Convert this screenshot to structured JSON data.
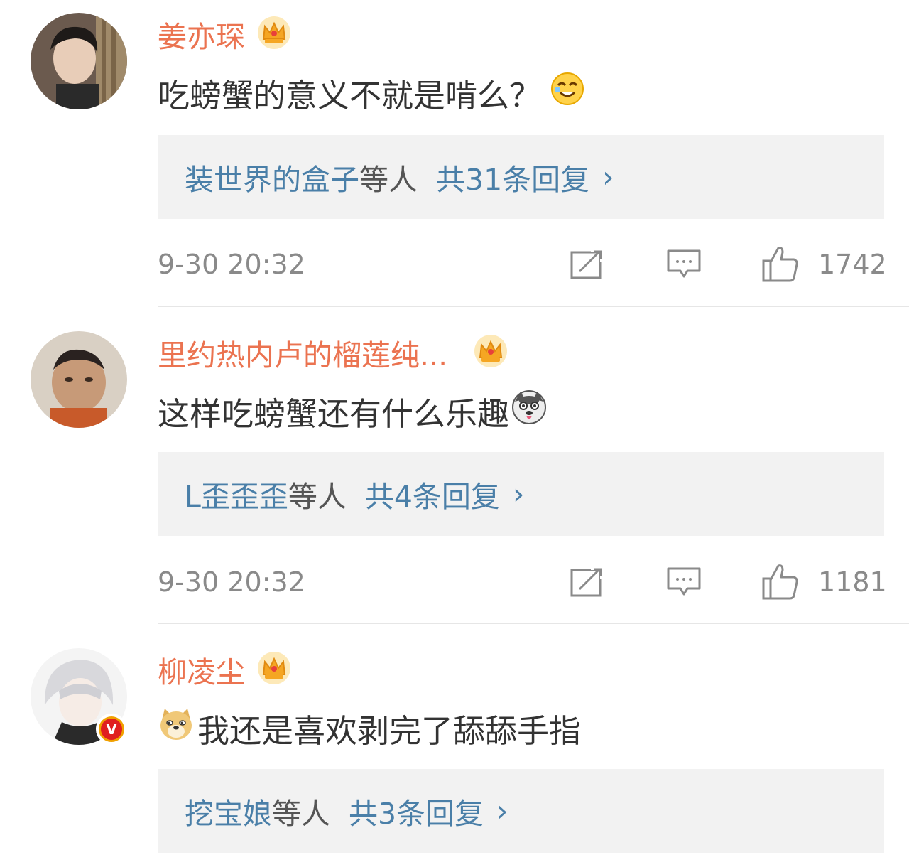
{
  "comments": [
    {
      "username": "姜亦琛",
      "text": "吃螃蟹的意义不就是啃么？",
      "emoji": "laughing-face-emoji",
      "reply_names": "装世界的盒子",
      "reply_others": "等人",
      "reply_count": "共31条回复",
      "reply_chevron": "›",
      "timestamp": "9-30 20:32",
      "likes": "1742",
      "badge": "crown-icon",
      "verified": false
    },
    {
      "username": "里约热内卢的榴莲纯...",
      "text": "这样吃螃蟹还有什么乐趣",
      "emoji": "husky-face-emoji",
      "reply_names": "L歪歪歪",
      "reply_others": "等人",
      "reply_count": "共4条回复",
      "reply_chevron": "›",
      "timestamp": "9-30 20:32",
      "likes": "1181",
      "badge": "crown-icon",
      "verified": false
    },
    {
      "username": "柳凌尘",
      "text": "我还是喜欢剥完了舔舔手指",
      "emoji": "doge-face-emoji",
      "reply_names": "挖宝娘",
      "reply_others": "等人",
      "reply_count": "共3条回复",
      "reply_chevron": "›",
      "badge": "crown-icon",
      "verified": true,
      "verified_label": "V"
    }
  ],
  "colors": {
    "username": "#eb7350",
    "link": "#4a7fa8",
    "meta": "#8a8a8a",
    "reply_bg": "#f2f2f2",
    "crown": "#f5a623"
  }
}
